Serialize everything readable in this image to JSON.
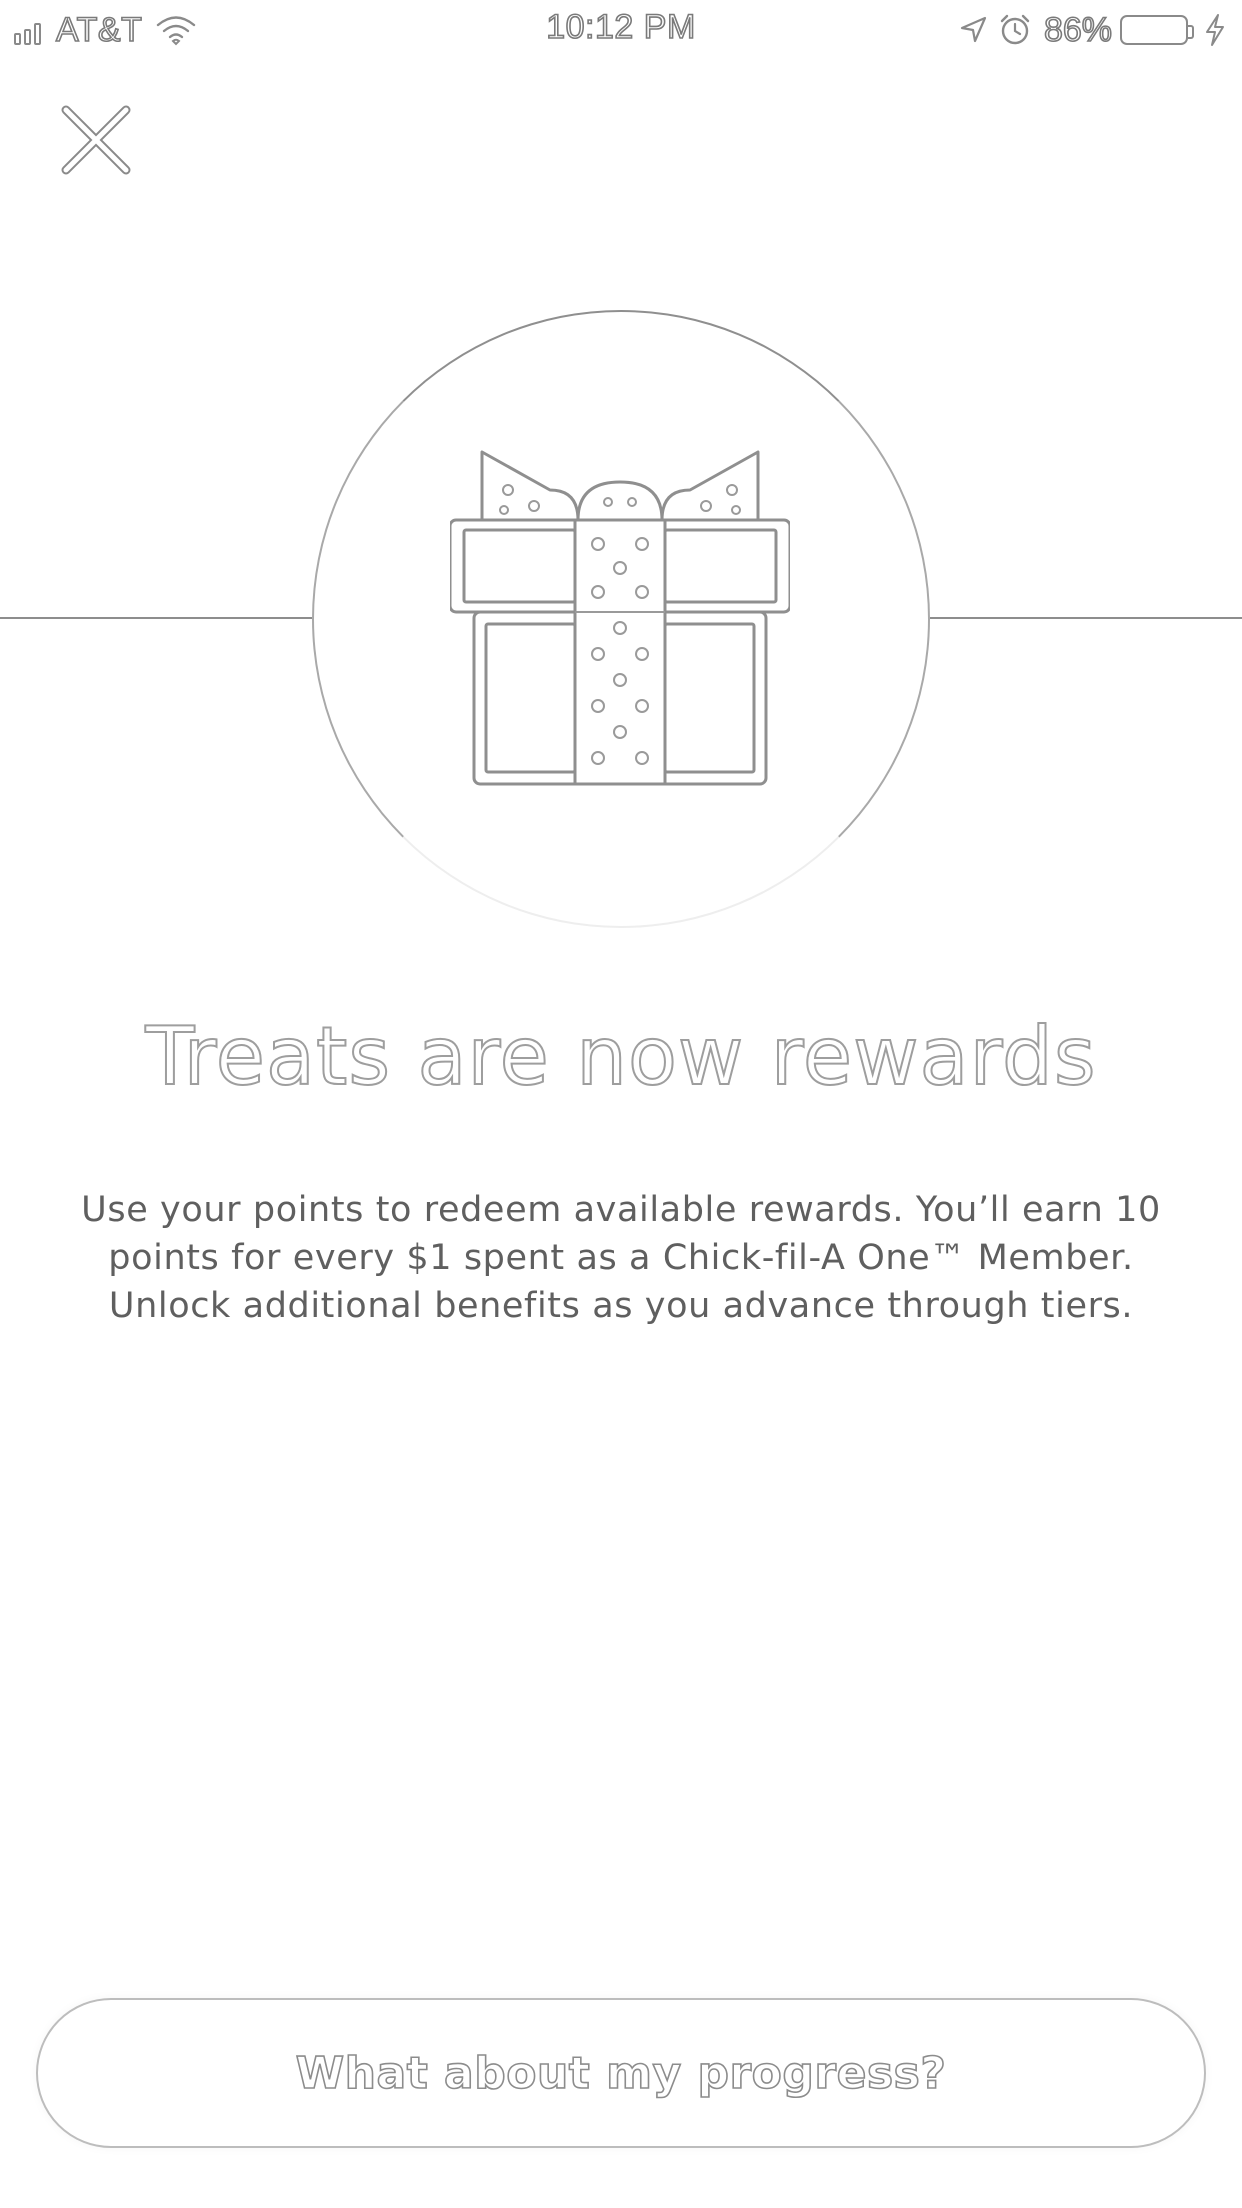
{
  "status_bar": {
    "carrier": "AT&T",
    "time": "10:12 PM",
    "battery_percent": "86%",
    "icons": [
      "signal-icon",
      "wifi-icon",
      "location-arrow-icon",
      "alarm-icon",
      "battery-icon",
      "charging-bolt-icon"
    ]
  },
  "close_icon": "close-icon",
  "hero": {
    "icon": "gift-icon"
  },
  "headline": "Treats are now rewards",
  "description": "Use your points to redeem available rewards. You’ll earn 10 points for every $1 spent as a Chick-fil-A One™ Member. Unlock additional benefits as you advance through tiers.",
  "cta": {
    "label": "What about my progress?"
  },
  "colors": {
    "background": "#ffffff",
    "outline": "#8f8f8f",
    "body_text": "#5f5f5f"
  }
}
